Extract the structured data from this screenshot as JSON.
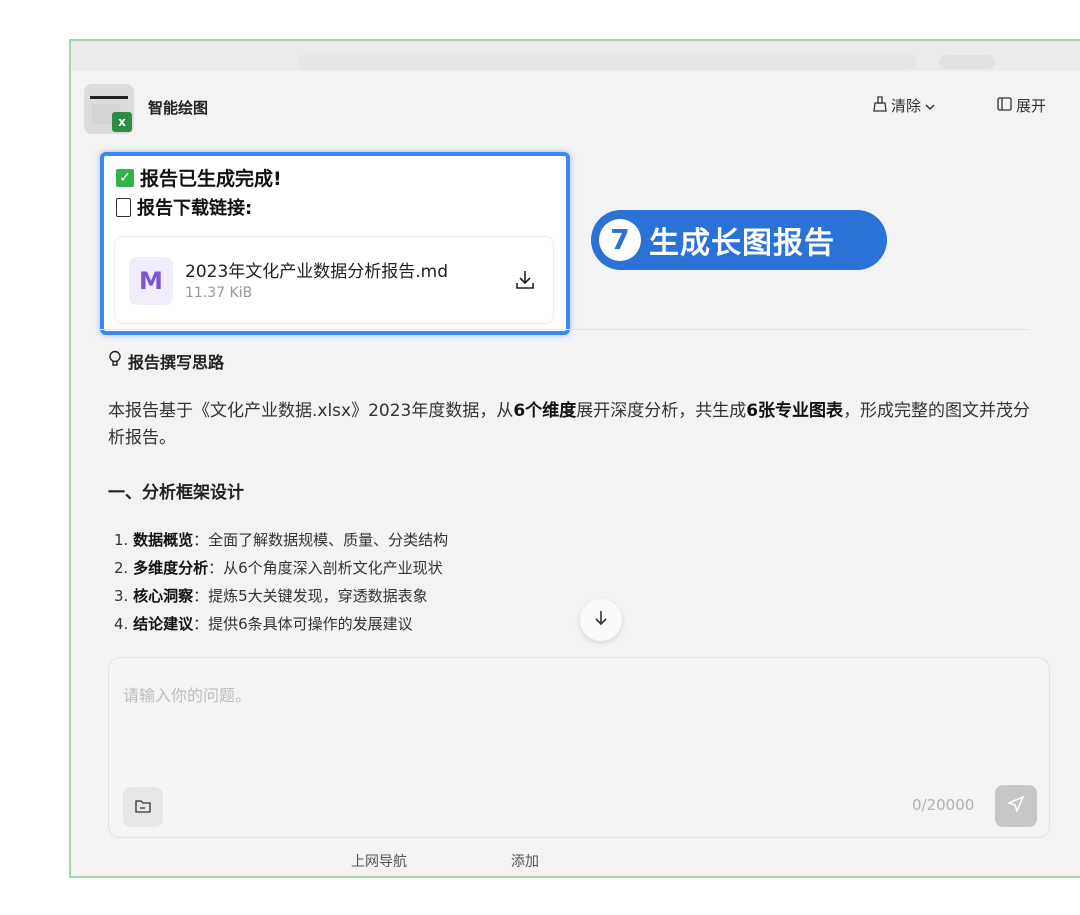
{
  "header": {
    "app_title": "智能绘图",
    "clear_label": "清除",
    "expand_label": "展开"
  },
  "result_card": {
    "line1": "报告已生成完成!",
    "line2": "报告下载链接:",
    "file": {
      "icon_letter": "M",
      "name": "2023年文化产业数据分析报告.md",
      "size": "11.37 KiB"
    }
  },
  "step_badge": {
    "number": "7",
    "label": "生成长图报告"
  },
  "report": {
    "section_title": "报告撰写思路",
    "intro_prefix": "本报告基于《文化产业数据.xlsx》2023年度数据，从",
    "intro_bold1": "6个维度",
    "intro_mid": "展开深度分析，共生成",
    "intro_bold2": "6张专业图表",
    "intro_suffix": "，形成完整的图文并茂分析报告。",
    "h2": "一、分析框架设计",
    "items": [
      {
        "num": "1.",
        "title": "数据概览",
        "desc": "：全面了解数据规模、质量、分类结构"
      },
      {
        "num": "2.",
        "title": "多维度分析",
        "desc": "：从6个角度深入剖析文化产业现状"
      },
      {
        "num": "3.",
        "title": "核心洞察",
        "desc": "：提炼5大关键发现，穿透数据表象"
      },
      {
        "num": "4.",
        "title": "结论建议",
        "desc": "：提供6条具体可操作的发展建议"
      }
    ]
  },
  "composer": {
    "placeholder": "请输入你的问题。",
    "counter": "0/20000"
  },
  "footer": {
    "link1": "上网导航",
    "link2": "添加"
  },
  "colors": {
    "accent": "#2b72d6",
    "highlight_border": "#3d88f0",
    "check": "#31b24a"
  }
}
